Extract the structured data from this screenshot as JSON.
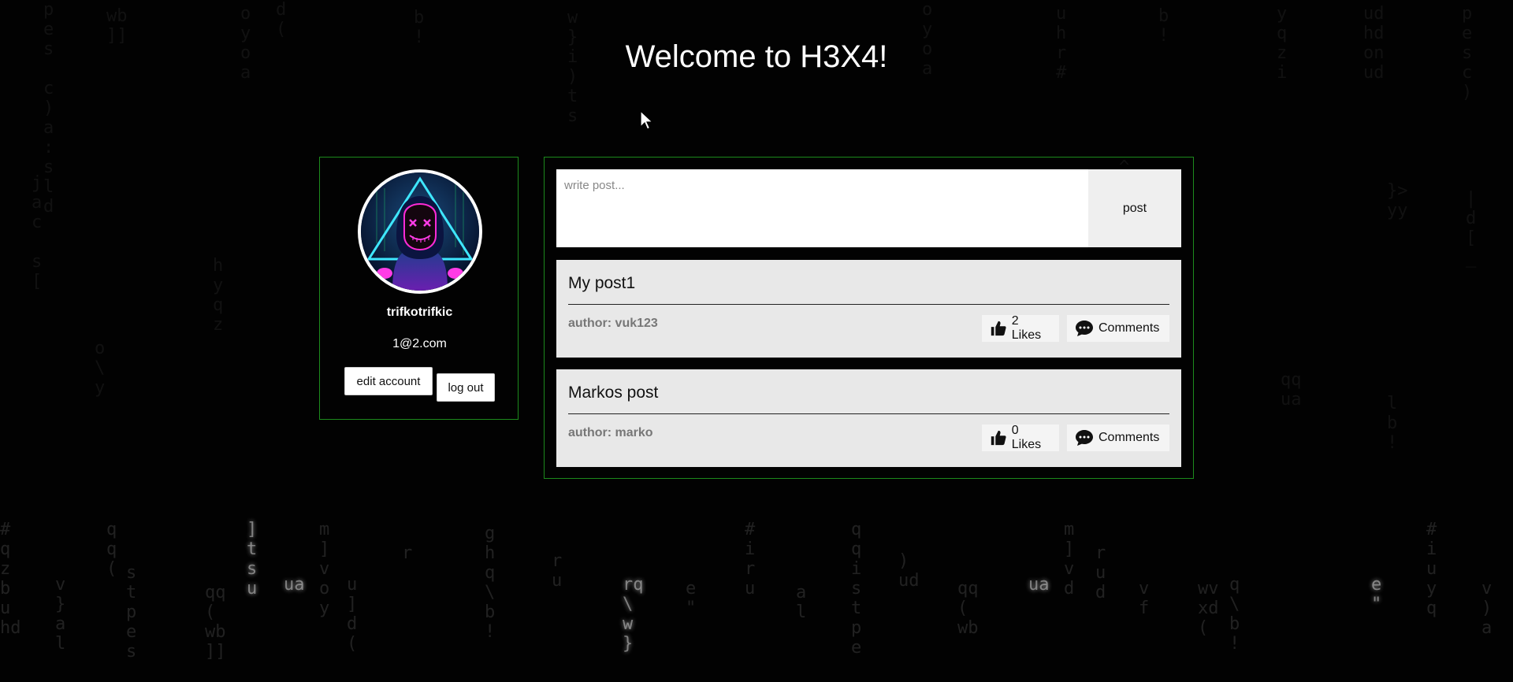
{
  "page": {
    "title": "Welcome to H3X4!"
  },
  "profile": {
    "username": "trifkotrifkic",
    "email": "1@2.com",
    "edit_button": "edit account",
    "logout_button": "log out",
    "avatar_icon": "masked-hacker-avatar"
  },
  "composer": {
    "placeholder": "write post...",
    "value": "",
    "post_button": "post"
  },
  "posts": [
    {
      "title": "My post1",
      "author": "author: vuk123",
      "likes": "2 Likes",
      "comments": "Comments",
      "like_icon": "thumbs-up-icon",
      "comment_icon": "speech-bubble-icon"
    },
    {
      "title": "Markos post",
      "author": "author: marko",
      "likes": "0 Likes",
      "comments": "Comments",
      "like_icon": "thumbs-up-icon",
      "comment_icon": "speech-bubble-icon"
    }
  ],
  "colors": {
    "background": "#020202",
    "panel_border": "#1c8a1c",
    "post_background": "#e8e8e8",
    "text_light": "#ffffff"
  }
}
